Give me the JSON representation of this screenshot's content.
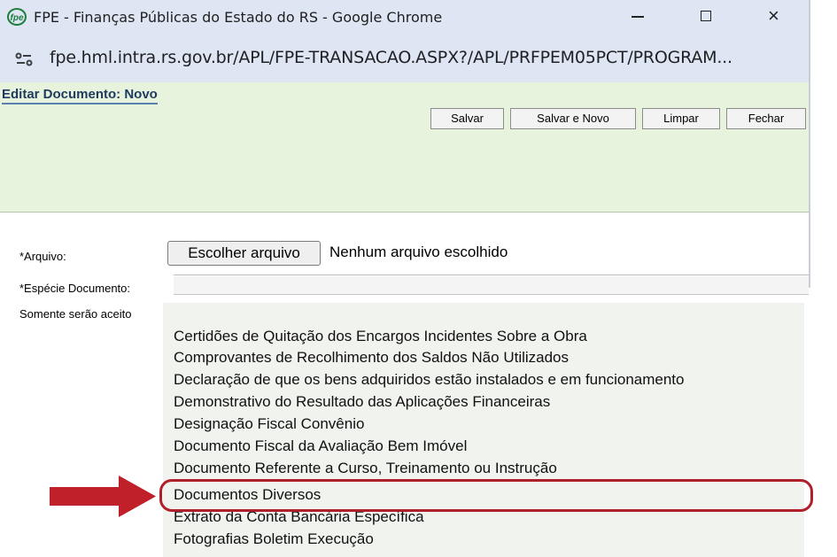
{
  "window": {
    "title": "FPE - Finanças Públicas do Estado do RS - Google Chrome",
    "logo_text": "fpe",
    "controls": {
      "minimize": "minimize",
      "maximize": "maximize",
      "close": "×"
    }
  },
  "browser": {
    "url": "fpe.hml.intra.rs.gov.br/APL/FPE-TRANSACAO.ASPX?/APL/PRFPEM05PCT/PROGRAM..."
  },
  "page": {
    "title": "Editar Documento: Novo",
    "toolbar": {
      "save_label": "Salvar",
      "save_new_label": "Salvar e Novo",
      "clear_label": "Limpar",
      "close_label": "Fechar"
    }
  },
  "form": {
    "arquivo_label": "*Arquivo:",
    "file_button_label": "Escolher arquivo",
    "file_status": "Nenhum arquivo escolhido",
    "especie_label": "*Espécie Documento:",
    "somente_label": "Somente serão aceito"
  },
  "dropdown": {
    "options": [
      "Certidões de Quitação dos Encargos Incidentes Sobre a Obra",
      "Comprovantes de Recolhimento dos Saldos Não Utilizados",
      "Declaração de que os bens adquiridos estão instalados e em funcionamento",
      "Demonstrativo do Resultado das Aplicações Financeiras",
      "Designação Fiscal Convênio",
      "Documento Fiscal da Avaliação Bem Imóvel",
      "Documento Referente a Curso, Treinamento ou Instrução",
      "Documentos Diversos",
      "Extrato da Conta Bancária Específica",
      "Fotografias Boletim Execução"
    ],
    "highlighted_option": "Documentos Diversos"
  },
  "colors": {
    "header_green": "#e8f3dd",
    "annotation_red": "#b0202a"
  }
}
